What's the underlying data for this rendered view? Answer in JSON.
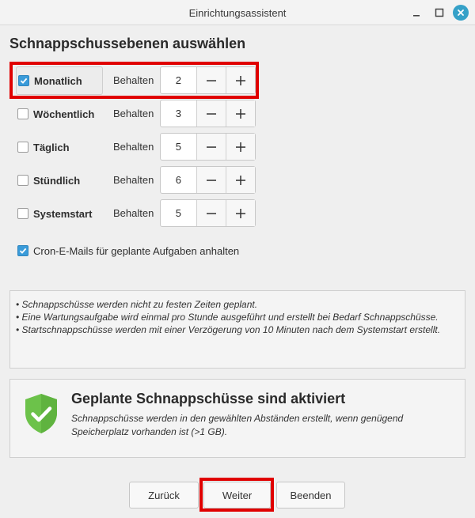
{
  "window": {
    "title": "Einrichtungsassistent"
  },
  "page": {
    "heading": "Schnappschussebenen auswählen"
  },
  "levels": [
    {
      "label": "Monatlich",
      "checked": true,
      "keep_label": "Behalten",
      "value": "2"
    },
    {
      "label": "Wöchentlich",
      "checked": false,
      "keep_label": "Behalten",
      "value": "3"
    },
    {
      "label": "Täglich",
      "checked": false,
      "keep_label": "Behalten",
      "value": "5"
    },
    {
      "label": "Stündlich",
      "checked": false,
      "keep_label": "Behalten",
      "value": "6"
    },
    {
      "label": "Systemstart",
      "checked": false,
      "keep_label": "Behalten",
      "value": "5"
    }
  ],
  "cron": {
    "label": "Cron-E-Mails für geplante Aufgaben anhalten",
    "checked": true
  },
  "notes": [
    "• Schnappschüsse werden nicht zu festen Zeiten geplant.",
    "• Eine Wartungsaufgabe wird einmal pro Stunde ausgeführt und erstellt bei Bedarf Schnappschüsse.",
    "• Startschnappschüsse werden mit einer Verzögerung von 10 Minuten nach dem Systemstart erstellt."
  ],
  "status": {
    "title": "Geplante Schnappschüsse sind aktiviert",
    "description": "Schnappschüsse werden in den gewählten Abständen erstellt, wenn genügend Speicherplatz vorhanden ist (>1 GB).",
    "icon": "shield-check-icon",
    "color": "#6cc24a"
  },
  "buttons": {
    "back": "Zurück",
    "next": "Weiter",
    "finish": "Beenden"
  },
  "colors": {
    "accent": "#3a9bd9",
    "highlight": "#e00000",
    "close": "#35a1c8"
  }
}
